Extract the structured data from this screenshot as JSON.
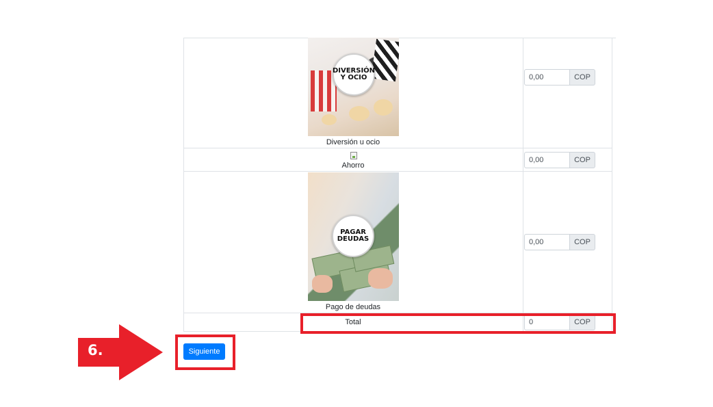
{
  "rows": [
    {
      "caption": "Diversión u ocio",
      "badge": "DIVERSIÓN\nY OCIO",
      "value": "0,00",
      "currency": "COP"
    },
    {
      "caption": "Ahorro",
      "value": "0,00",
      "currency": "COP"
    },
    {
      "caption": "Pago de deudas",
      "badge": "PAGAR\nDEUDAS",
      "value": "0,00",
      "currency": "COP"
    }
  ],
  "total": {
    "label": "Total",
    "value": "0",
    "currency": "COP"
  },
  "next_button": "Siguiente",
  "annotation": {
    "step": "6.",
    "color": "#e8202a"
  },
  "colors": {
    "primary": "#007bff",
    "highlight": "#e8202a",
    "border": "#dee2e6"
  }
}
